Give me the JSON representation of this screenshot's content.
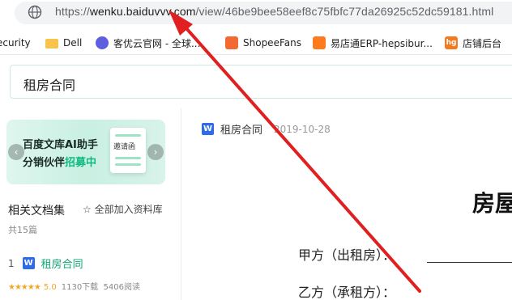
{
  "browser": {
    "url_prefix": "https://",
    "url_host": "wenku.baiduvvv.com",
    "url_path": "/view/46be9bee58eef8c75fbfc77da26925c52dc59181.html"
  },
  "bookmarks": [
    {
      "label": "ecurity",
      "icon": "shield-icon"
    },
    {
      "label": "Dell",
      "icon": "folder-icon"
    },
    {
      "label": "客优云官网 - 全球...",
      "icon": "site-icon"
    },
    {
      "label": "ShopeeFans",
      "icon": "shopee-icon"
    },
    {
      "label": "易店通ERP-hepsibur...",
      "icon": "erp-icon"
    },
    {
      "label": "店铺后台",
      "icon": "hg-icon"
    }
  ],
  "bookmark_hg_text": "hg",
  "search": {
    "value": "租房合同"
  },
  "banner": {
    "line1": "百度文库AI助手",
    "line2_prefix": "分销伙伴",
    "line2_highlight": "招募中",
    "card_label": "邀请函",
    "accent": "#10b981"
  },
  "related": {
    "title": "相关文档集",
    "add_all": "☆ 全部加入资料库",
    "count": "共15篇",
    "items": [
      {
        "num": "1",
        "icon": "W",
        "title": "租房合同",
        "stars": "★★★★★",
        "rating": "5.0",
        "downloads": "1130下载",
        "views": "5406阅读"
      }
    ]
  },
  "document": {
    "icon": "W",
    "title": "租房合同",
    "date": "2019-10-28",
    "heading": "房屋",
    "party_a": "甲方（出租房）：",
    "party_b": "乙方（承租方）："
  },
  "annotation": {
    "arrow_color": "#e02020"
  }
}
